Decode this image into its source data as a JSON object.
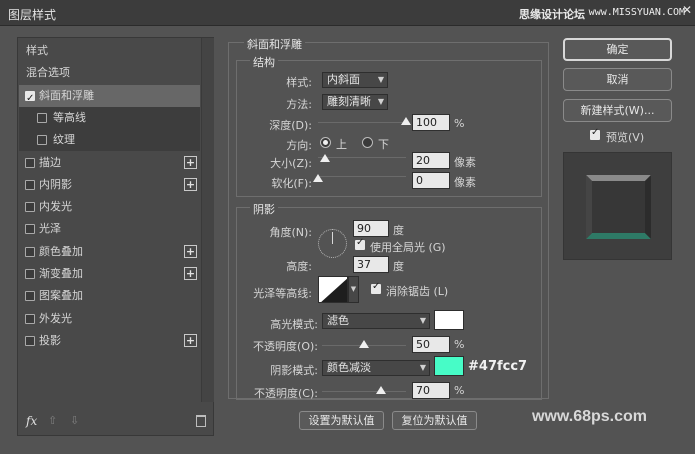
{
  "window": {
    "title": "图层样式",
    "watermark": "思缘设计论坛",
    "watermark_url": "www.MISSYUAN.COM",
    "close_glyph": "✕"
  },
  "sidebar": {
    "items": [
      {
        "label": "样式",
        "checkbox": false,
        "checked": false,
        "plus": false
      },
      {
        "label": "混合选项",
        "checkbox": false,
        "checked": false,
        "plus": false
      },
      {
        "label": "斜面和浮雕",
        "checkbox": true,
        "checked": true,
        "plus": false,
        "selected": true
      },
      {
        "label": "等高线",
        "checkbox": true,
        "checked": false,
        "plus": false,
        "sub": true
      },
      {
        "label": "纹理",
        "checkbox": true,
        "checked": false,
        "plus": false,
        "sub": true
      },
      {
        "label": "描边",
        "checkbox": true,
        "checked": false,
        "plus": true
      },
      {
        "label": "内阴影",
        "checkbox": true,
        "checked": false,
        "plus": true
      },
      {
        "label": "内发光",
        "checkbox": true,
        "checked": false,
        "plus": false
      },
      {
        "label": "光泽",
        "checkbox": true,
        "checked": false,
        "plus": false
      },
      {
        "label": "颜色叠加",
        "checkbox": true,
        "checked": false,
        "plus": true
      },
      {
        "label": "渐变叠加",
        "checkbox": true,
        "checked": false,
        "plus": true
      },
      {
        "label": "图案叠加",
        "checkbox": true,
        "checked": false,
        "plus": false
      },
      {
        "label": "外发光",
        "checkbox": true,
        "checked": false,
        "plus": false
      },
      {
        "label": "投影",
        "checkbox": true,
        "checked": false,
        "plus": true
      }
    ],
    "fx_label": "fx"
  },
  "bevel": {
    "section_title": "斜面和浮雕",
    "structure_title": "结构",
    "style_label": "样式:",
    "style_value": "内斜面",
    "technique_label": "方法:",
    "technique_value": "雕刻清晰",
    "depth_label": "深度(D):",
    "depth_value": "100",
    "depth_unit": "%",
    "depth_pos": 1.0,
    "direction_label": "方向:",
    "dir_up": "上",
    "dir_down": "下",
    "size_label": "大小(Z):",
    "size_value": "20",
    "size_unit": "像素",
    "size_pos": 0.08,
    "soften_label": "软化(F):",
    "soften_value": "0",
    "soften_unit": "像素",
    "soften_pos": 0.0
  },
  "shading": {
    "title": "阴影",
    "angle_label": "角度(N):",
    "angle_value": "90",
    "angle_unit": "度",
    "global_light_label": "使用全局光 (G)",
    "altitude_label": "高度:",
    "altitude_value": "37",
    "altitude_unit": "度",
    "gloss_label": "光泽等高线:",
    "antialias_label": "消除锯齿 (L)",
    "highlight_mode_label": "高光模式:",
    "highlight_mode_value": "滤色",
    "highlight_color": "#ffffff",
    "highlight_opacity_label": "不透明度(O):",
    "highlight_opacity_value": "50",
    "highlight_opacity_unit": "%",
    "highlight_opacity_pos": 0.5,
    "shadow_mode_label": "阴影模式:",
    "shadow_mode_value": "颜色减淡",
    "shadow_color": "#47fcc7",
    "shadow_color_text": "#47fcc7",
    "shadow_opacity_label": "不透明度(C):",
    "shadow_opacity_value": "70",
    "shadow_opacity_unit": "%",
    "shadow_opacity_pos": 0.7
  },
  "buttons": {
    "ok": "确定",
    "cancel": "取消",
    "new_style": "新建样式(W)...",
    "preview_label": "预览(V)",
    "make_default": "设置为默认值",
    "reset_default": "复位为默认值"
  },
  "footer_watermark": "www.68ps.com"
}
